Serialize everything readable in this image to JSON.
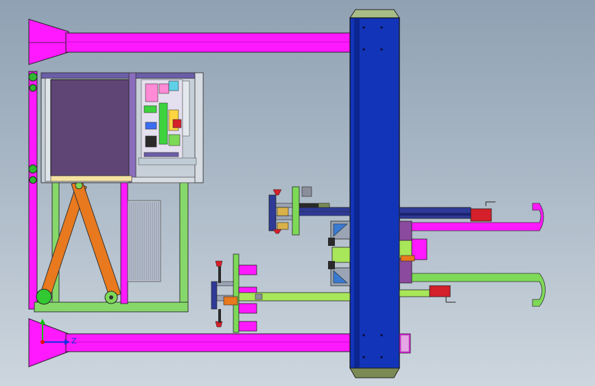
{
  "viewport": {
    "background_top": "#8fa1b3",
    "background_bottom": "#cdd6de"
  },
  "colors": {
    "magenta": "#ff19ff",
    "blue_column": "#1234b8",
    "purple_panel": "#5f4476",
    "green": "#7ed957",
    "light_green": "#a8e65a",
    "orange": "#e8791e",
    "red": "#d4202a",
    "olive": "#7a8a55",
    "steel": "#9aa4b4"
  },
  "triad": {
    "x_label": "",
    "y_label": "",
    "z_label": "Z",
    "x_color": "#e01010",
    "y_color": "#10c010",
    "z_color": "#1030e0"
  },
  "icons": [
    "coordinate-triad-icon"
  ]
}
